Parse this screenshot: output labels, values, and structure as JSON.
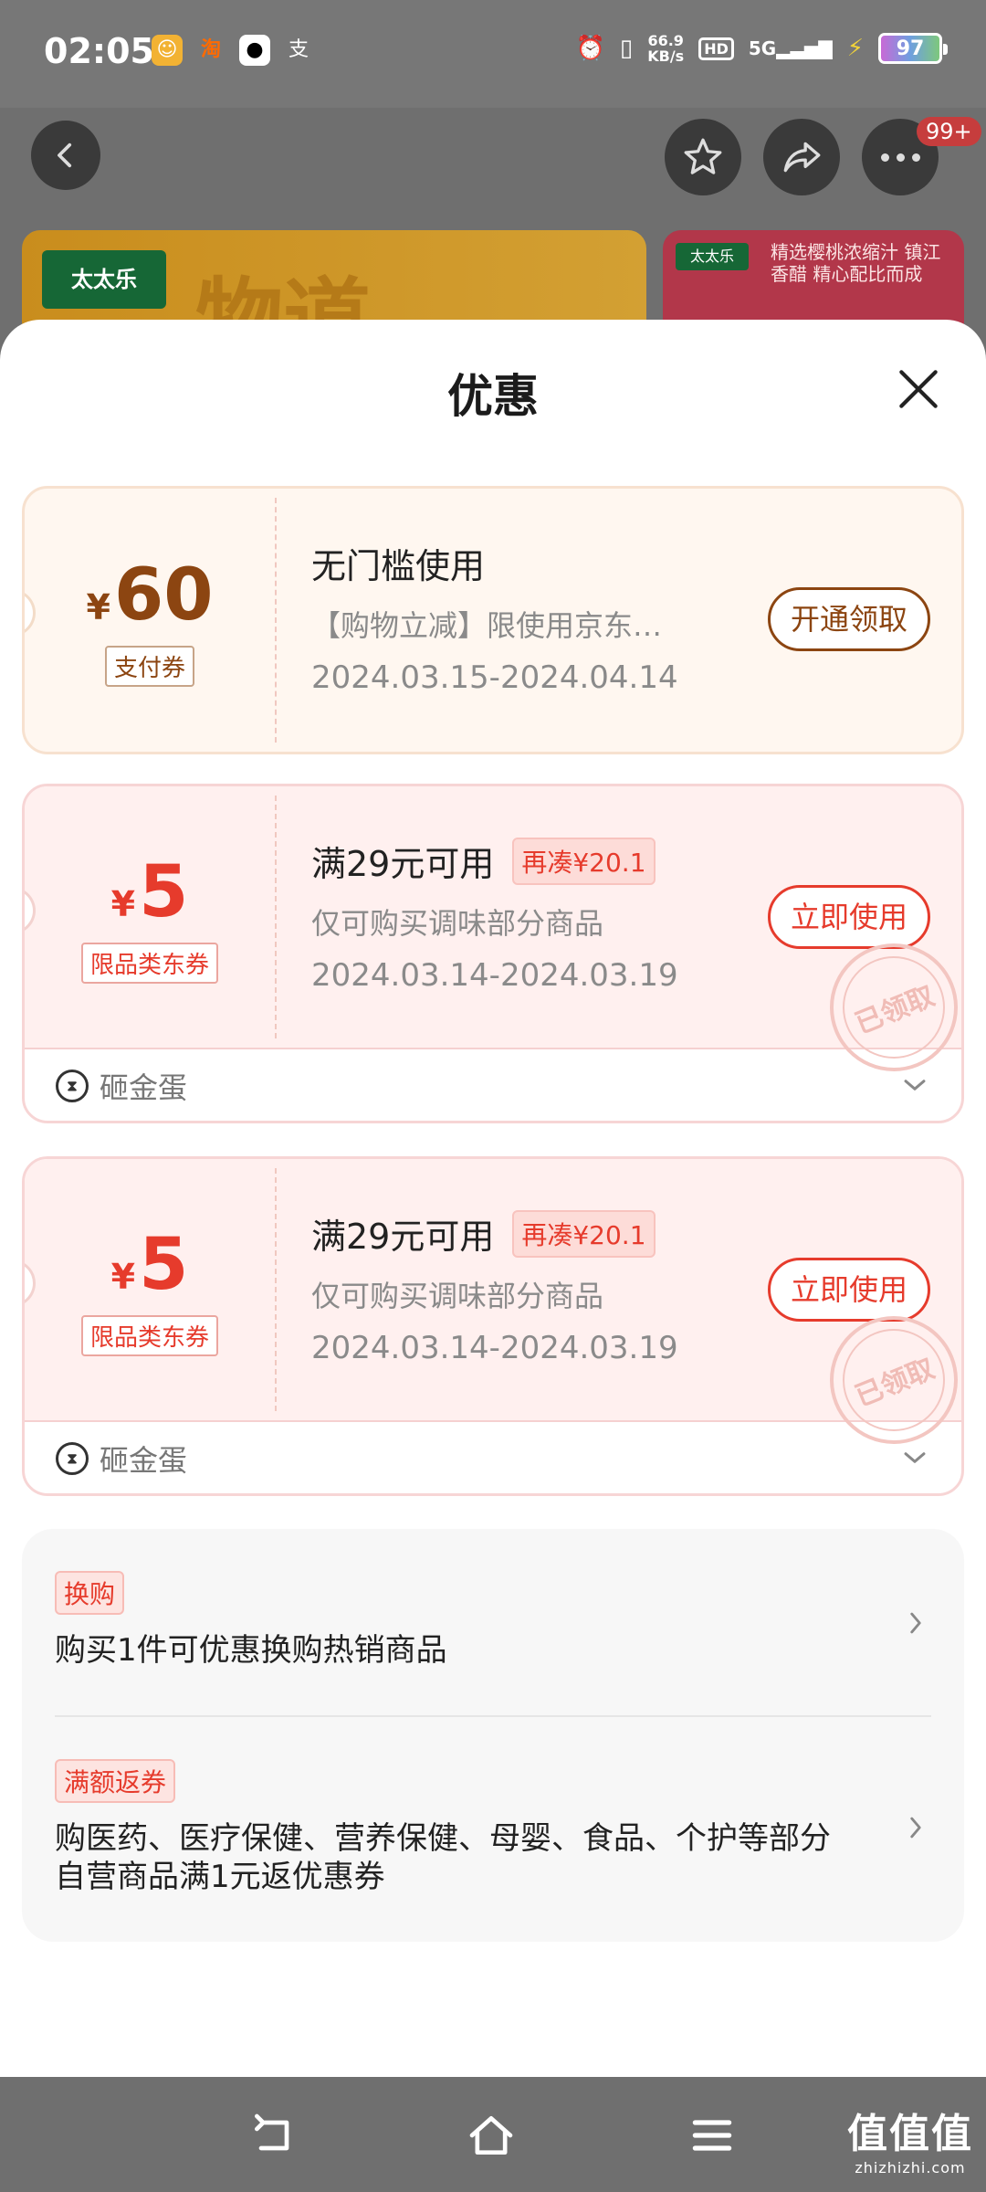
{
  "status_bar": {
    "time": "02:05",
    "notif_icons": [
      "app-icon",
      "taobao-icon",
      "qq-icon",
      "alipay-icon"
    ],
    "notif_glyph_alipay": "支",
    "net_speed_value": "66.9",
    "net_speed_unit": "KB/s",
    "hd": "HD",
    "signal": "5G",
    "battery": "97"
  },
  "header": {
    "more_badge": "99+"
  },
  "banners": {
    "left_brand": "太太乐",
    "left_text": "物道",
    "right_brand": "太太乐",
    "right_text": "精选樱桃浓缩汁 镇江香醋 精心配比而成"
  },
  "sheet": {
    "title": "优惠"
  },
  "coupons": [
    {
      "currency": "¥",
      "amount": "60",
      "tag": "支付券",
      "title": "无门槛使用",
      "desc": "【购物立减】限使用京东…",
      "date": "2024.03.15-2024.04.14",
      "action": "开通领取"
    },
    {
      "currency": "¥",
      "amount": "5",
      "tag": "限品类东券",
      "title": "满29元可用",
      "chip": "再凑¥20.1",
      "desc": "仅可购买调味部分商品",
      "date": "2024.03.14-2024.03.19",
      "action": "立即使用",
      "stamp": "已领取",
      "footer": "砸金蛋"
    },
    {
      "currency": "¥",
      "amount": "5",
      "tag": "限品类东券",
      "title": "满29元可用",
      "chip": "再凑¥20.1",
      "desc": "仅可购买调味部分商品",
      "date": "2024.03.14-2024.03.19",
      "action": "立即使用",
      "stamp": "已领取",
      "footer": "砸金蛋"
    }
  ],
  "benefits": [
    {
      "tag": "换购",
      "text": "购买1件可优惠换购热销商品"
    },
    {
      "tag": "满额返券",
      "text": "购医药、医疗保健、营养保健、母婴、食品、个护等部分自营商品满1元返优惠券"
    }
  ],
  "watermark": {
    "main": "值值值",
    "sub": "zhizhizhi.com"
  },
  "colors": {
    "pay_brown": "#8c4511",
    "coupon_red": "#e63b2c",
    "overlay_gray": "#6f6f6f"
  }
}
